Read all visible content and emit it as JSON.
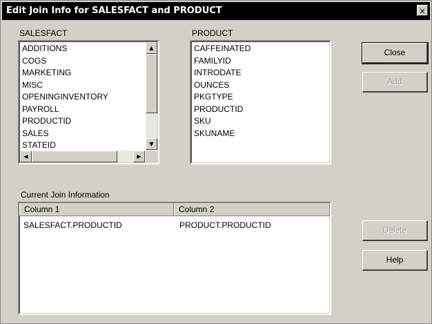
{
  "window": {
    "title": "Edit Join Info for SALESFACT and PRODUCT",
    "close_glyph": "×"
  },
  "left_list": {
    "label": "SALESFACT",
    "items": [
      "ADDITIONS",
      "COGS",
      "MARKETING",
      "MISC",
      "OPENINGINVENTORY",
      "PAYROLL",
      "PRODUCTID",
      "SALES",
      "STATEID"
    ]
  },
  "right_list": {
    "label": "PRODUCT",
    "items": [
      "CAFFEINATED",
      "FAMILYID",
      "INTRODATE",
      "OUNCES",
      "PKGTYPE",
      "PRODUCTID",
      "SKU",
      "SKUNAME"
    ]
  },
  "buttons": {
    "close": "Close",
    "add": "Add",
    "delete": "Delete",
    "help": "Help"
  },
  "join_info": {
    "label": "Current Join Information",
    "columns": [
      "Column 1",
      "Column 2"
    ],
    "rows": [
      [
        "SALESFACT.PRODUCTID",
        "PRODUCT.PRODUCTID"
      ]
    ]
  },
  "icons": {
    "scroll_up": "▲",
    "scroll_down": "▼",
    "scroll_left": "◀",
    "scroll_right": "▶"
  }
}
